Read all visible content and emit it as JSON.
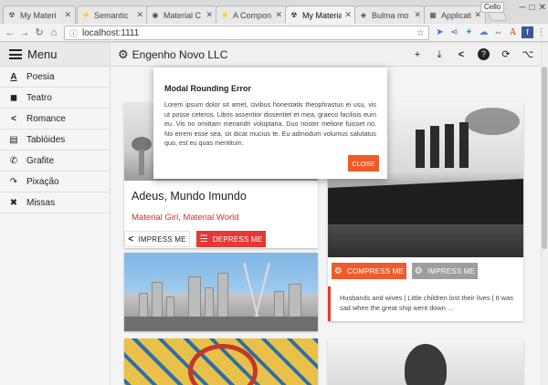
{
  "browser": {
    "tabs": [
      {
        "title": "My Materi",
        "icon": "☢",
        "active": false
      },
      {
        "title": "Semantic",
        "icon": "⚡",
        "active": false
      },
      {
        "title": "Material C",
        "icon": "◉",
        "active": false
      },
      {
        "title": "A Compon",
        "icon": "⚡",
        "active": false
      },
      {
        "title": "My Materia",
        "icon": "☢",
        "active": true
      },
      {
        "title": "Bulma mo",
        "icon": "◈",
        "active": false
      },
      {
        "title": "Application",
        "icon": "▦",
        "active": false
      }
    ],
    "user": "Cello",
    "url": "localhost:1111"
  },
  "sidebar": {
    "title": "Menu",
    "items": [
      {
        "label": "Poesia",
        "icon": "A"
      },
      {
        "label": "Teatro",
        "icon": "◼"
      },
      {
        "label": "Romance",
        "icon": "<"
      },
      {
        "label": "Tablóides",
        "icon": "▤"
      },
      {
        "label": "Grafite",
        "icon": "✆"
      },
      {
        "label": "Pixação",
        "icon": "↷"
      },
      {
        "label": "Missas",
        "icon": "✖"
      }
    ]
  },
  "topbar": {
    "brand": "Engenho Novo LLC",
    "actions": [
      "+",
      "⤓",
      "<",
      "?",
      "⟳",
      "⌥"
    ]
  },
  "cards": {
    "left": {
      "title": "Adeus, Mundo Imundo",
      "subtitle": "Material Girl, Material World",
      "impress": "IMPRESS ME",
      "depress": "DEPRESS ME"
    },
    "right": {
      "compress": "COMPRESS ME",
      "impress": "IMPRESS ME",
      "quote": "Husbands and wives | Little children lost their lives | It was sad when the great ship went down ..."
    }
  },
  "modal": {
    "title": "Modal Rounding Error",
    "body": "Lorem ipsum dolor sit amet, civibus honestatis theophrastus ei usu, vis ut posse ceteros. Libris assentior dissentiet et mea, graeco facilisis eum eu. Vis no omittam menandri voluptaria. Duo noster meliore fuisset no. No errem esse sea, sit dicat mucius te. Eu admodum volumus salutatus quo, est eu quas mentitum.",
    "close": "CLOSE"
  },
  "colors": {
    "accent": "#ef5b2a",
    "danger": "#e53935",
    "grey_button": "#9e9e9e",
    "subtitle_red": "#d32f2f"
  }
}
